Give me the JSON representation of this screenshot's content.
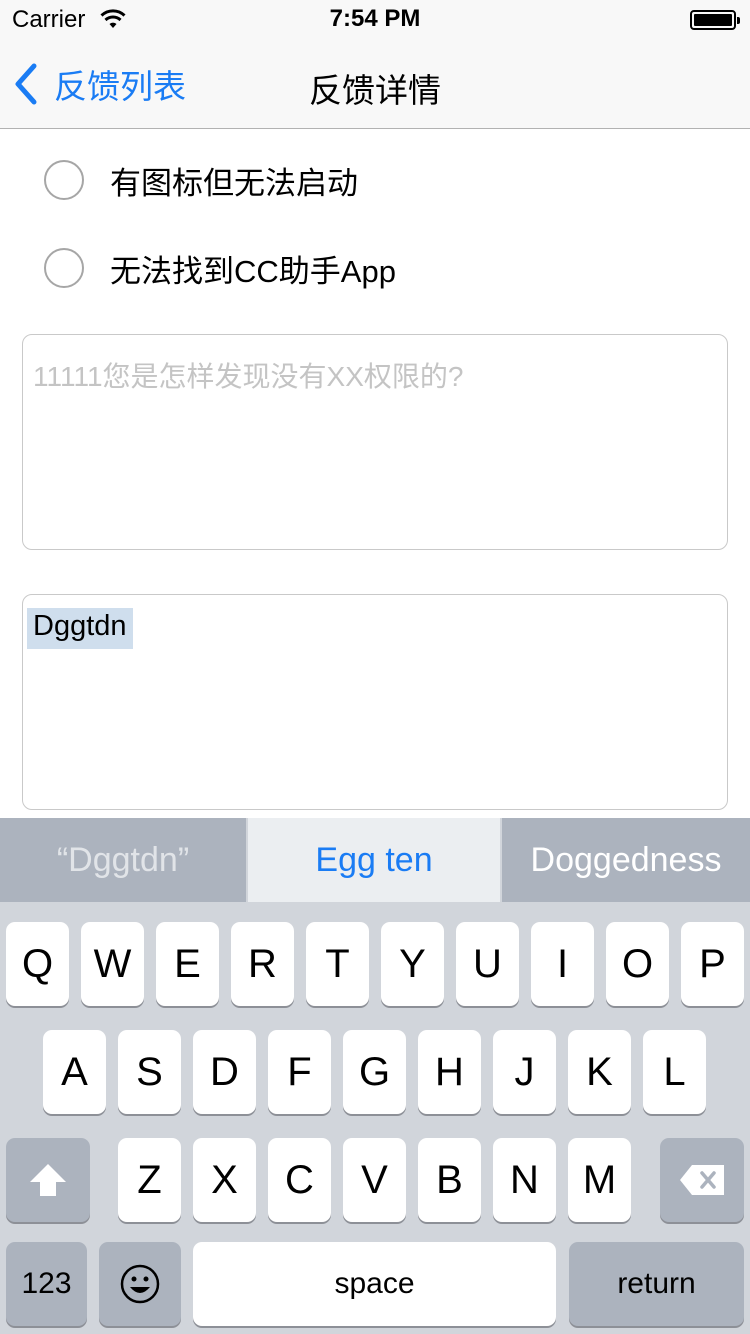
{
  "status_bar": {
    "carrier": "Carrier",
    "time": "7:54 PM"
  },
  "nav": {
    "back_label": "反馈列表",
    "title": "反馈详情"
  },
  "options": [
    {
      "label": "有图标但无法启动",
      "selected": false
    },
    {
      "label": "无法找到CC助手App",
      "selected": false
    }
  ],
  "question_field": {
    "placeholder": "11111您是怎样发现没有XX权限的?"
  },
  "answer_field": {
    "value": "Dggtdn"
  },
  "keyboard": {
    "suggestions": [
      "“Dggtdn”",
      "Egg ten",
      "Doggedness"
    ],
    "row1": [
      "Q",
      "W",
      "E",
      "R",
      "T",
      "Y",
      "U",
      "I",
      "O",
      "P"
    ],
    "row2": [
      "A",
      "S",
      "D",
      "F",
      "G",
      "H",
      "J",
      "K",
      "L"
    ],
    "row3": [
      "Z",
      "X",
      "C",
      "V",
      "B",
      "N",
      "M"
    ],
    "numbers_label": "123",
    "space_label": "space",
    "return_label": "return"
  }
}
